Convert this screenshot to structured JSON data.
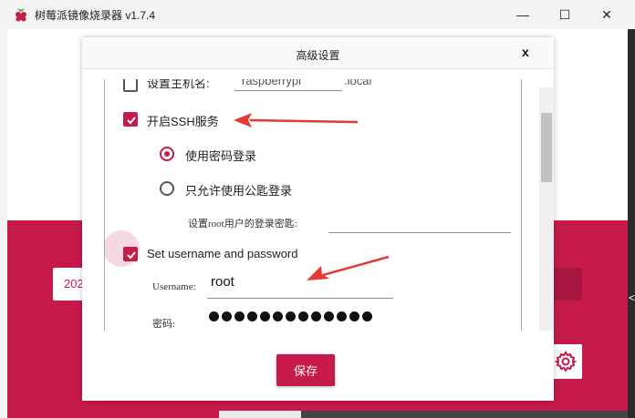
{
  "window": {
    "title": "树莓派镜像烧录器 v1.7.4",
    "controls": {
      "minimize": "—",
      "maximize": "☐",
      "close": "✕"
    }
  },
  "background": {
    "field_text": "202",
    "edge_text": "<"
  },
  "dialog": {
    "title": "高级设置",
    "close_label": "x",
    "partial_top_label": "设置主机名:",
    "partial_top_value": "raspberrypi",
    "partial_top_suffix": ".local",
    "ssh": {
      "label": "开启SSH服务",
      "checked": true
    },
    "ssh_auth": {
      "password_label": "使用密码登录",
      "password_selected": true,
      "pubkey_label": "只允许使用公匙登录",
      "pubkey_selected": false,
      "root_password_label": "设置root用户的登录密匙:"
    },
    "user": {
      "label": "Set username and password",
      "checked": true,
      "username_label": "Username:",
      "username_value": "root",
      "password_label": "密码:"
    },
    "save_label": "保存"
  },
  "colors": {
    "accent": "#c51a4a",
    "arrow": "#e53935"
  },
  "icons": {
    "app": "raspberry-icon",
    "gear": "gear-icon"
  }
}
